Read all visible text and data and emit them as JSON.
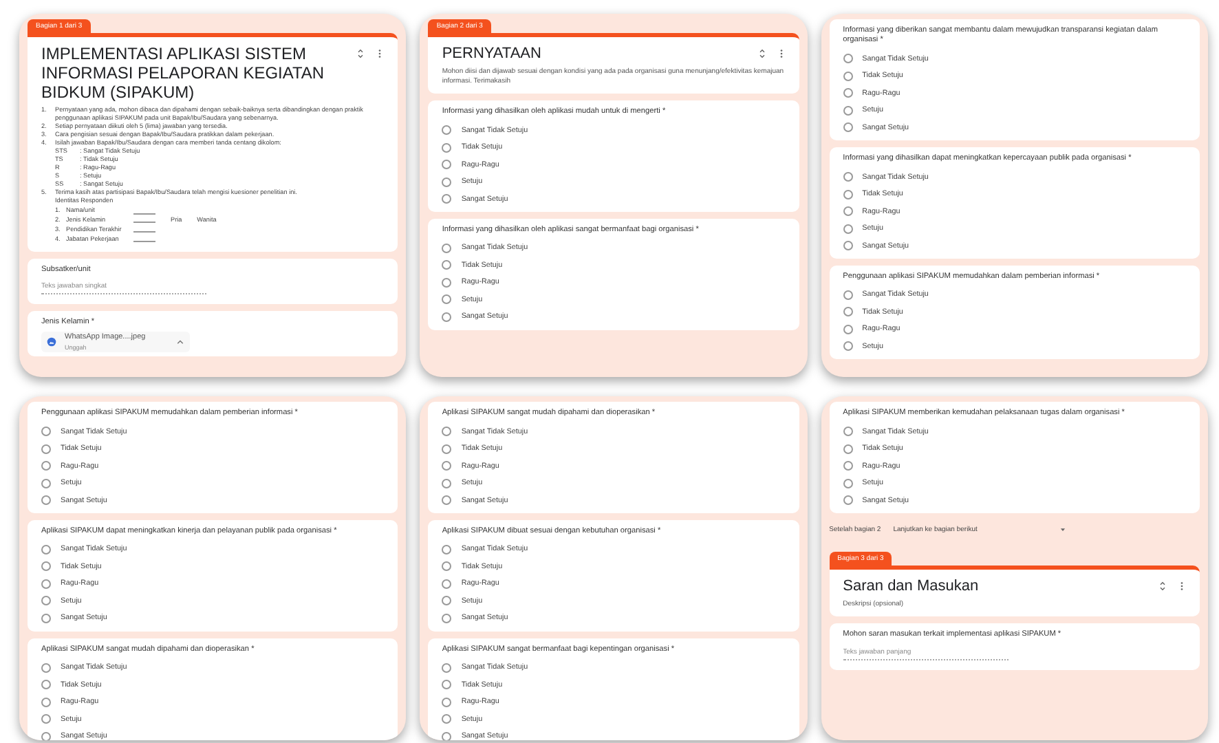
{
  "panels": [
    {
      "items": [
        {
          "kind": "header",
          "tag": "Bagian 1 dari 3",
          "title": "IMPLEMENTASI APLIKASI SISTEM INFORMASI PELAPORAN KEGIATAN BIDKUM (SIPAKUM)",
          "instructions": [
            {
              "number": "1.",
              "text": "Pernyataan yang ada, mohon dibaca dan dipahami dengan sebaik-baiknya serta dibandingkan dengan praktik penggunaan aplikasi SIPAKUM pada unit Bapak/Ibu/Saudara yang sebenarnya."
            },
            {
              "number": "2.",
              "text": "Setiap pernyataan diikuti oleh 5 (lima) jawaban yang tersedia."
            },
            {
              "number": "3.",
              "text": "Cara pengisian sesuai dengan Bapak/Ibu/Saudara pratikkan dalam pekerjaan."
            },
            {
              "number": "4.",
              "text": "Isilah jawaban Bapak/Ibu/Saudara dengan cara memberi tanda centang dikolom:",
              "legend": [
                {
                  "code": "STS",
                  "label": ": Sangat Tidak Setuju"
                },
                {
                  "code": "TS",
                  "label": ": Tidak Setuju"
                },
                {
                  "code": "R",
                  "label": ": Ragu-Ragu"
                },
                {
                  "code": "S",
                  "label": ": Setuju"
                },
                {
                  "code": "SS",
                  "label": ": Sangat Setuju"
                }
              ]
            },
            {
              "number": "5.",
              "text": "Terima kasih atas partisipasi Bapak/Ibu/Saudara telah mengisi kuesioner penelitian ini.",
              "subtitle": "Identitas Responden",
              "fields": [
                {
                  "number": "1.",
                  "label": "Nama/unit"
                },
                {
                  "number": "2.",
                  "label": "Jenis Kelamin",
                  "choices": [
                    "Pria",
                    "Wanita"
                  ]
                },
                {
                  "number": "3.",
                  "label": "Pendidikan Terakhir"
                },
                {
                  "number": "4.",
                  "label": "Jabatan Pekerjaan"
                }
              ]
            }
          ]
        },
        {
          "kind": "text",
          "title": "Subsatker/unit",
          "placeholder": "Teks jawaban singkat"
        },
        {
          "kind": "attachment",
          "title": "Jenis Kelamin *",
          "file": "WhatsApp Image....jpeg",
          "sub": "Unggah"
        }
      ]
    },
    {
      "items": [
        {
          "kind": "header",
          "tag": "Bagian 2 dari 3",
          "title": "PERNYATAAN",
          "description": "Mohon diisi dan dijawab sesuai dengan kondisi yang ada pada organisasi guna menunjang/efektivitas kemajuan informasi. Terimakasih"
        },
        {
          "kind": "choice",
          "title": "Informasi yang dihasilkan oleh aplikasi mudah untuk di mengerti *",
          "options": [
            {
              "label": "Sangat Tidak Setuju",
              "selected": false
            },
            {
              "label": "Tidak Setuju",
              "selected": false
            },
            {
              "label": "Ragu-Ragu",
              "selected": false
            },
            {
              "label": "Setuju",
              "selected": false
            },
            {
              "label": "Sangat Setuju",
              "selected": false
            }
          ]
        },
        {
          "kind": "choice",
          "title": "Informasi yang dihasilkan oleh aplikasi sangat bermanfaat bagi organisasi *",
          "options": [
            {
              "label": "Sangat Tidak Setuju",
              "selected": false
            },
            {
              "label": "Tidak Setuju",
              "selected": false
            },
            {
              "label": "Ragu-Ragu",
              "selected": false
            },
            {
              "label": "Setuju",
              "selected": false
            },
            {
              "label": "Sangat Setuju",
              "selected": false
            }
          ]
        }
      ]
    },
    {
      "items": [
        {
          "kind": "choice",
          "title": "Informasi yang diberikan sangat membantu dalam mewujudkan transparansi kegiatan dalam organisasi *",
          "options": [
            {
              "label": "Sangat Tidak Setuju",
              "selected": false
            },
            {
              "label": "Tidak Setuju",
              "selected": false
            },
            {
              "label": "Ragu-Ragu",
              "selected": false
            },
            {
              "label": "Setuju",
              "selected": false
            },
            {
              "label": "Sangat Setuju",
              "selected": false
            }
          ]
        },
        {
          "kind": "choice",
          "title": "Informasi yang dihasilkan dapat meningkatkan kepercayaan publik pada organisasi *",
          "options": [
            {
              "label": "Sangat Tidak Setuju",
              "selected": false
            },
            {
              "label": "Tidak Setuju",
              "selected": false
            },
            {
              "label": "Ragu-Ragu",
              "selected": false
            },
            {
              "label": "Setuju",
              "selected": false
            },
            {
              "label": "Sangat Setuju",
              "selected": false
            }
          ]
        },
        {
          "kind": "choice",
          "title": "Penggunaan aplikasi SIPAKUM memudahkan dalam pemberian informasi *",
          "options": [
            {
              "label": "Sangat Tidak Setuju",
              "selected": false
            },
            {
              "label": "Tidak Setuju",
              "selected": false
            },
            {
              "label": "Ragu-Ragu",
              "selected": false
            },
            {
              "label": "Setuju",
              "selected": false
            }
          ]
        }
      ]
    },
    {
      "items": [
        {
          "kind": "choice",
          "title": "Penggunaan aplikasi SIPAKUM memudahkan dalam pemberian informasi *",
          "options": [
            {
              "label": "Sangat Tidak Setuju",
              "selected": false
            },
            {
              "label": "Tidak Setuju",
              "selected": false
            },
            {
              "label": "Ragu-Ragu",
              "selected": false
            },
            {
              "label": "Setuju",
              "selected": false
            },
            {
              "label": "Sangat Setuju",
              "selected": false
            }
          ]
        },
        {
          "kind": "choice",
          "title": "Aplikasi SIPAKUM dapat meningkatkan kinerja dan pelayanan publik pada organisasi *",
          "options": [
            {
              "label": "Sangat Tidak Setuju",
              "selected": false
            },
            {
              "label": "Tidak Setuju",
              "selected": false
            },
            {
              "label": "Ragu-Ragu",
              "selected": false
            },
            {
              "label": "Setuju",
              "selected": false
            },
            {
              "label": "Sangat Setuju",
              "selected": false
            }
          ]
        },
        {
          "kind": "choice",
          "title": "Aplikasi SIPAKUM sangat mudah dipahami dan dioperasikan *",
          "options": [
            {
              "label": "Sangat Tidak Setuju",
              "selected": false
            },
            {
              "label": "Tidak Setuju",
              "selected": false
            },
            {
              "label": "Ragu-Ragu",
              "selected": false
            },
            {
              "label": "Setuju",
              "selected": false
            },
            {
              "label": "Sangat Setuju",
              "selected": false
            }
          ]
        }
      ]
    },
    {
      "items": [
        {
          "kind": "choice",
          "title": "Aplikasi SIPAKUM sangat mudah dipahami dan dioperasikan *",
          "options": [
            {
              "label": "Sangat Tidak Setuju",
              "selected": false
            },
            {
              "label": "Tidak Setuju",
              "selected": false
            },
            {
              "label": "Ragu-Ragu",
              "selected": false
            },
            {
              "label": "Setuju",
              "selected": false
            },
            {
              "label": "Sangat Setuju",
              "selected": false
            }
          ]
        },
        {
          "kind": "choice",
          "title": "Aplikasi SIPAKUM dibuat sesuai dengan kebutuhan organisasi *",
          "options": [
            {
              "label": "Sangat Tidak Setuju",
              "selected": false
            },
            {
              "label": "Tidak Setuju",
              "selected": false
            },
            {
              "label": "Ragu-Ragu",
              "selected": false
            },
            {
              "label": "Setuju",
              "selected": false
            },
            {
              "label": "Sangat Setuju",
              "selected": false
            }
          ]
        },
        {
          "kind": "choice",
          "title": "Aplikasi SIPAKUM sangat bermanfaat bagi kepentingan organisasi *",
          "options": [
            {
              "label": "Sangat Tidak Setuju",
              "selected": false
            },
            {
              "label": "Tidak Setuju",
              "selected": false
            },
            {
              "label": "Ragu-Ragu",
              "selected": false
            },
            {
              "label": "Setuju",
              "selected": false
            },
            {
              "label": "Sangat Setuju",
              "selected": false
            }
          ]
        }
      ]
    },
    {
      "items": [
        {
          "kind": "choice",
          "title": "Aplikasi SIPAKUM memberikan kemudahan pelaksanaan tugas dalam organisasi *",
          "options": [
            {
              "label": "Sangat Tidak Setuju",
              "selected": false
            },
            {
              "label": "Tidak Setuju",
              "selected": false
            },
            {
              "label": "Ragu-Ragu",
              "selected": false
            },
            {
              "label": "Setuju",
              "selected": false
            },
            {
              "label": "Sangat Setuju",
              "selected": false
            }
          ]
        },
        {
          "kind": "section_nav",
          "label": "Setelah bagian 2",
          "value": "Lanjutkan ke bagian berikut"
        },
        {
          "kind": "header",
          "tag": "Bagian 3 dari 3",
          "title": "Saran dan Masukan",
          "description": "Deskripsi (opsional)"
        },
        {
          "kind": "text",
          "title": "Mohon saran masukan terkait implementasi aplikasi SIPAKUM *",
          "placeholder": "Teks jawaban panjang"
        }
      ]
    }
  ]
}
